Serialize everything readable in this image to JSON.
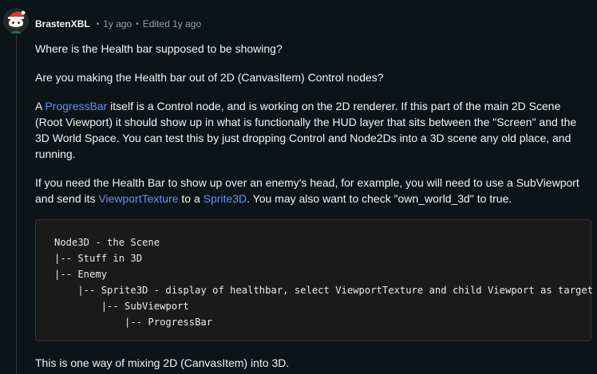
{
  "comment": {
    "author": {
      "username": "BrastenXBL",
      "avatar_icon": "snoo-avatar-icon"
    },
    "meta": {
      "separator": "•",
      "age": "1y ago",
      "edited": "Edited 1y ago"
    },
    "body": {
      "paragraph1": "Where is the Health bar supposed to be showing?",
      "paragraph2": "Are you making the Health bar out of 2D (CanvasItem) Control nodes?",
      "paragraph3": {
        "a": "A ",
        "link_progressbar": "ProgressBar",
        "b": " itself is a Control node, and is working on the 2D renderer. If this part of the main 2D Scene (Root Viewport) it should show up in what is functionally the HUD layer that sits between the \"Screen\" and the 3D World Space. You can test this by just dropping Control and Node2Ds into a 3D scene any old place, and running."
      },
      "paragraph4": {
        "a": "If you need the Health Bar to show up over an enemy's head, for example, you will need to use a SubViewport and send its ",
        "link_viewporttexture": "ViewportTexture",
        "b": " to a ",
        "link_sprite3d": "Sprite3D",
        "c": ". You may also want to check \"own_world_3d\" to true."
      },
      "code_lines": [
        "Node3D - the Scene",
        "|-- Stuff in 3D",
        "|-- Enemy",
        "    |-- Sprite3D - display of healthbar, select ViewportTexture and child Viewport as target",
        "        |-- SubViewport",
        "            |-- ProgressBar"
      ],
      "paragraph5": "This is one way of mixing 2D (CanvasItem) into 3D."
    }
  },
  "colors": {
    "background": "#0b1416",
    "text": "#f2f4f5",
    "muted": "#8ba2ad",
    "link": "#648efc",
    "code_bg": "#1a1a1b",
    "code_border": "#343536"
  }
}
